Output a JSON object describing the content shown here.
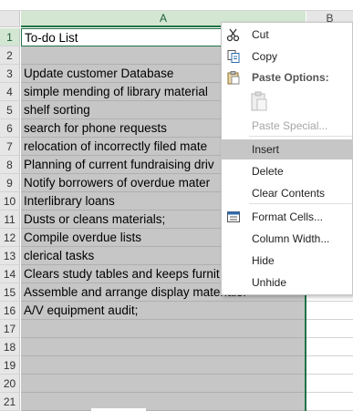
{
  "columns": {
    "a": "A",
    "b": "B"
  },
  "rows": [
    {
      "num": "1",
      "text": "To-do List"
    },
    {
      "num": "2",
      "text": ""
    },
    {
      "num": "3",
      "text": "Update customer Database"
    },
    {
      "num": "4",
      "text": "simple mending of library material"
    },
    {
      "num": "5",
      "text": "shelf sorting"
    },
    {
      "num": "6",
      "text": "search for phone requests"
    },
    {
      "num": "7",
      "text": "relocation of incorrectly filed mate"
    },
    {
      "num": "8",
      "text": "Planning of current fundraising driv"
    },
    {
      "num": "9",
      "text": "Notify borrowers of overdue mater"
    },
    {
      "num": "10",
      "text": "Interlibrary loans"
    },
    {
      "num": "11",
      "text": "Dusts or cleans materials;"
    },
    {
      "num": "12",
      "text": "Compile overdue lists"
    },
    {
      "num": "13",
      "text": "clerical tasks"
    },
    {
      "num": "14",
      "text": "Clears study tables and keeps furnit"
    },
    {
      "num": "15",
      "text": "Assemble and arrange display materials."
    },
    {
      "num": "16",
      "text": "A/V equipment audit;"
    },
    {
      "num": "17",
      "text": ""
    },
    {
      "num": "18",
      "text": ""
    },
    {
      "num": "19",
      "text": ""
    },
    {
      "num": "20",
      "text": ""
    },
    {
      "num": "21",
      "text": ""
    }
  ],
  "context_menu": {
    "cut": "Cut",
    "copy": "Copy",
    "paste_options": "Paste Options:",
    "paste_special": "Paste Special...",
    "insert": "Insert",
    "delete": "Delete",
    "clear_contents": "Clear Contents",
    "format_cells": "Format Cells...",
    "column_width": "Column Width...",
    "hide": "Hide",
    "unhide": "Unhide"
  },
  "colors": {
    "selection": "#c6c6c6",
    "accent": "#217346",
    "hover": "#c6c6c6"
  }
}
